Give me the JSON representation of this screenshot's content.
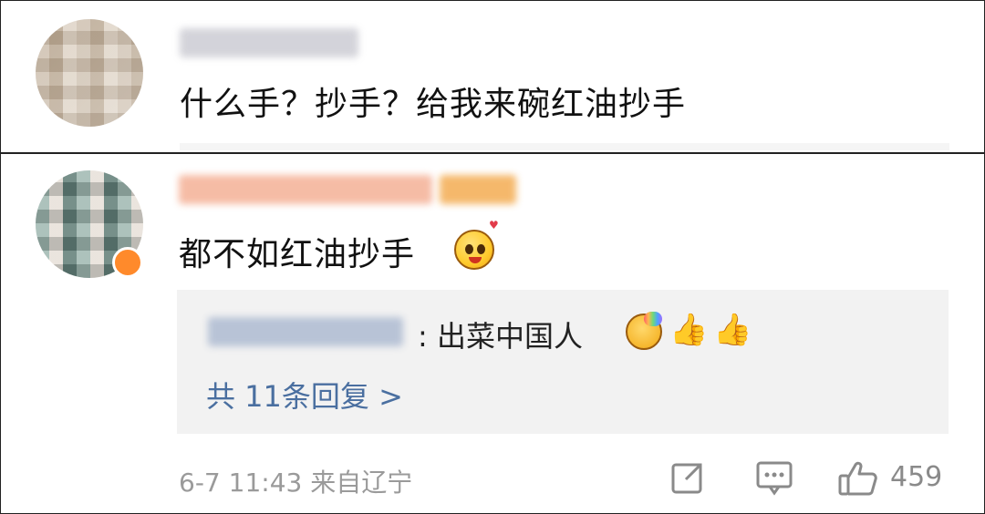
{
  "comment1": {
    "text": "什么手？抄手？给我来碗红油抄手"
  },
  "comment2": {
    "text": "都不如红油抄手",
    "reply": {
      "text_suffix": ": 出菜中国人",
      "more_label": "共 11条回复 >"
    },
    "meta": "6-7 11:43 来自辽宁",
    "like_count": "459"
  },
  "icons": [
    "share-icon",
    "comment-icon",
    "like-icon",
    "smiling-face-emoji",
    "rainbow-face-emoji",
    "thumbs-up-emoji"
  ]
}
